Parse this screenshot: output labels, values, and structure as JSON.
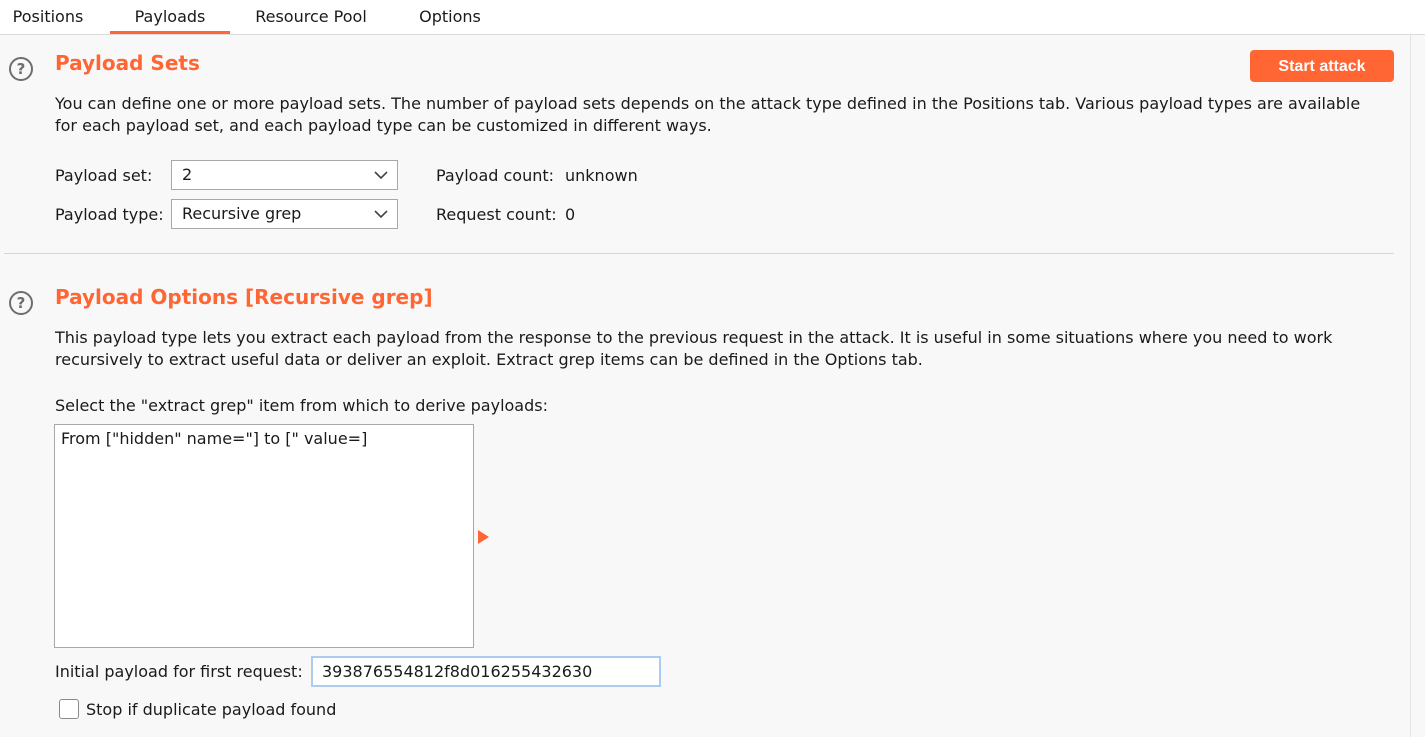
{
  "tabs": [
    {
      "label": "Positions",
      "active": false
    },
    {
      "label": "Payloads",
      "active": true
    },
    {
      "label": "Resource Pool",
      "active": false
    },
    {
      "label": "Options",
      "active": false
    }
  ],
  "colors": {
    "accent": "#ff6633",
    "heading": "#ff6633"
  },
  "payload_sets": {
    "heading": "Payload Sets",
    "start_attack_label": "Start attack",
    "description_lines": [
      "You can define one or more payload sets. The number of payload sets depends on the attack type defined in the Positions tab. Various payload types are available",
      "for each payload set, and each payload type can be customized in different ways."
    ],
    "payload_set_label": "Payload set:",
    "payload_set_value": "2",
    "payload_type_label": "Payload type:",
    "payload_type_value": "Recursive grep",
    "payload_count_label": "Payload count:",
    "payload_count_value": "unknown",
    "request_count_label": "Request count:",
    "request_count_value": "0"
  },
  "payload_options": {
    "heading": "Payload Options [Recursive grep]",
    "description_lines": [
      "This payload type lets you extract each payload from the response to the previous request in the attack. It is useful in some situations where you need to work",
      "recursively to extract useful data or deliver an exploit. Extract grep items can be defined in the Options tab."
    ],
    "select_label": "Select the \"extract grep\" item from which to derive payloads:",
    "grep_items": [
      "From [\"hidden\" name=\"] to [\" value=]"
    ],
    "initial_payload_label": "Initial payload for first request:",
    "initial_payload_value": "393876554812f8d016255432630",
    "stop_duplicate_label": "Stop if duplicate payload found",
    "stop_duplicate_checked": false
  },
  "icons": {
    "help": "help-circle-icon",
    "dropdown": "chevron-down-icon",
    "arrow": "play-arrow-icon"
  }
}
